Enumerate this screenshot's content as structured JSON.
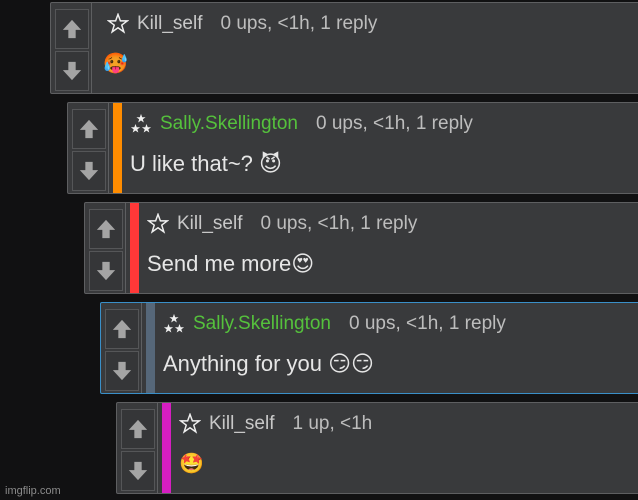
{
  "colors": {
    "panel": "#393a3c",
    "border": "#5e5f61",
    "green_user": "#55c13c",
    "orange_bar": "#ff8c00",
    "red_bar": "#ff3838",
    "slate_bar": "#566779",
    "magenta_bar": "#d61ec1",
    "blue_border": "#3a8fc8"
  },
  "comments": [
    {
      "username": "Kill_self",
      "meta": "0 ups, <1h, 1 reply",
      "body": "🥵",
      "badge": "star-outline-icon"
    },
    {
      "username": "Sally.Skellington",
      "meta": "0 ups, <1h, 1 reply",
      "body": "U like that~? 😈",
      "badge": "triple-star-icon"
    },
    {
      "username": "Kill_self",
      "meta": "0 ups, <1h, 1 reply",
      "body": "Send me more😍",
      "badge": "star-outline-icon"
    },
    {
      "username": "Sally.Skellington",
      "meta": "0 ups, <1h, 1 reply",
      "body": "Anything for you 😏😏",
      "badge": "triple-star-icon"
    },
    {
      "username": "Kill_self",
      "meta": "1 up, <1h",
      "body": "🤩",
      "badge": "star-outline-icon"
    }
  ],
  "watermark": "imgflip.com"
}
